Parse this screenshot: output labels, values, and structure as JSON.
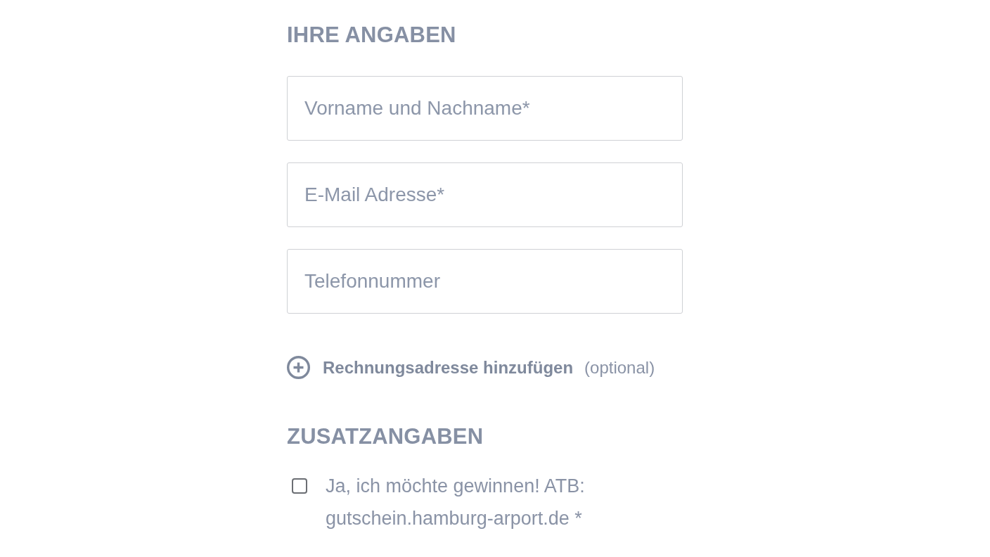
{
  "personal": {
    "heading": "IHRE ANGABEN",
    "fields": [
      {
        "placeholder": "Vorname und Nachname*"
      },
      {
        "placeholder": "E-Mail Adresse*"
      },
      {
        "placeholder": "Telefonnummer"
      }
    ],
    "add_link": {
      "label": "Rechnungsadresse hinzufügen",
      "note": "(optional)"
    }
  },
  "extras": {
    "heading": "ZUSATZANGABEN",
    "options": [
      {
        "label": "Ja, ich möchte gewinnen! ATB: gutschein.hamburg-arport.de *",
        "checked": false
      }
    ]
  }
}
